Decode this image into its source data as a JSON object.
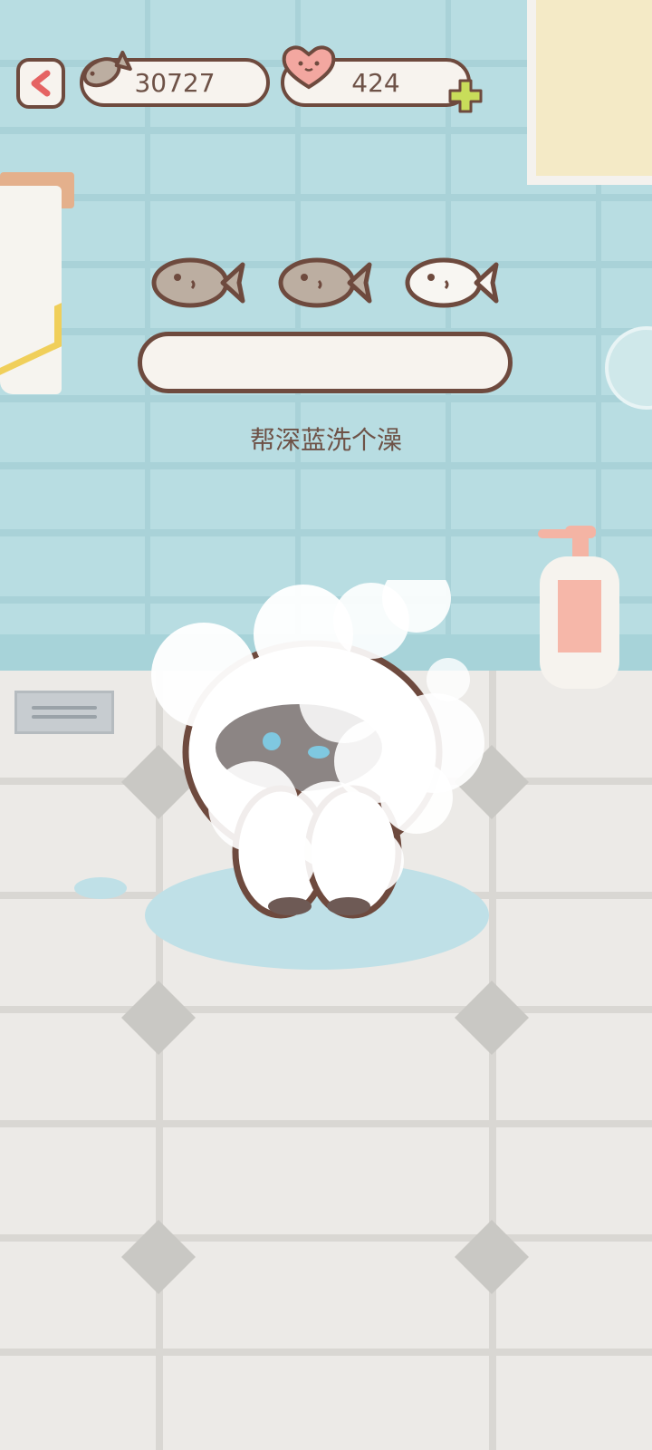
{
  "hud": {
    "fish_count": "30727",
    "heart_count": "424"
  },
  "task": {
    "label": "帮深蓝洗个澡",
    "fish_rewards": [
      "earned",
      "earned",
      "empty"
    ],
    "progress": 0
  },
  "colors": {
    "wall": "#b8dde2",
    "floor": "#eceae7",
    "outline": "#6e4a3e",
    "pill_bg": "#f7f3ee",
    "text": "#6e5247",
    "back_arrow": "#e56363",
    "heart": "#f3a7a0",
    "plus": "#c8dd5a"
  },
  "icons": [
    "back-arrow-icon",
    "fish-icon",
    "heart-icon",
    "plus-icon",
    "fish-reward-icon"
  ]
}
